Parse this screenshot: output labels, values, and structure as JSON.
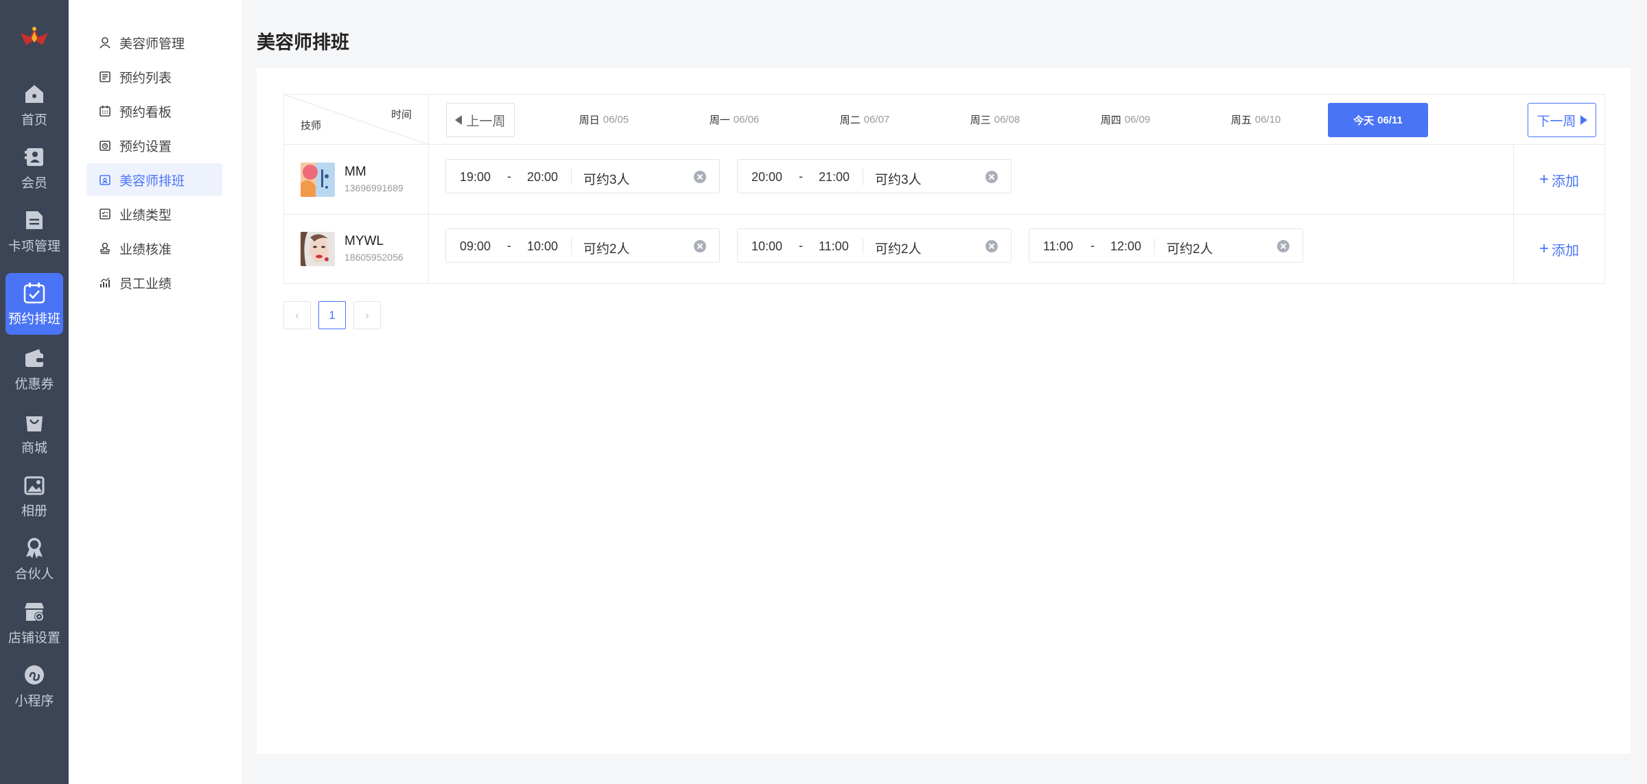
{
  "rail": {
    "items": [
      {
        "label": "首页",
        "icon": "home-icon"
      },
      {
        "label": "会员",
        "icon": "member-icon"
      },
      {
        "label": "卡项管理",
        "icon": "card-icon"
      },
      {
        "label": "预约排班",
        "icon": "calendar-icon"
      },
      {
        "label": "优惠券",
        "icon": "wallet-icon"
      },
      {
        "label": "商城",
        "icon": "bag-icon"
      },
      {
        "label": "相册",
        "icon": "album-icon"
      },
      {
        "label": "合伙人",
        "icon": "partner-icon"
      },
      {
        "label": "店铺设置",
        "icon": "store-settings-icon"
      },
      {
        "label": "小程序",
        "icon": "miniprogram-icon"
      }
    ],
    "active_index": 3,
    "accent": "#4a74f6",
    "bg": "#3c4556"
  },
  "submenu": {
    "items": [
      {
        "label": "美容师管理",
        "icon": "user-icon"
      },
      {
        "label": "预约列表",
        "icon": "list-icon"
      },
      {
        "label": "预约看板",
        "icon": "board-icon"
      },
      {
        "label": "预约设置",
        "icon": "clock-settings-icon"
      },
      {
        "label": "美容师排班",
        "icon": "schedule-icon"
      },
      {
        "label": "业绩类型",
        "icon": "checklist-icon"
      },
      {
        "label": "业绩核准",
        "icon": "stamp-icon"
      },
      {
        "label": "员工业绩",
        "icon": "bar-chart-icon"
      }
    ],
    "active_index": 4
  },
  "page": {
    "title": "美容师排班"
  },
  "schedule": {
    "corner": {
      "top": "时间",
      "bottom": "技师"
    },
    "prev_week": "上一周",
    "next_week": "下一周",
    "days": [
      {
        "name": "周日",
        "date": "06/05"
      },
      {
        "name": "周一",
        "date": "06/06"
      },
      {
        "name": "周二",
        "date": "06/07"
      },
      {
        "name": "周三",
        "date": "06/08"
      },
      {
        "name": "周四",
        "date": "06/09"
      },
      {
        "name": "周五",
        "date": "06/10"
      },
      {
        "name": "今天",
        "date": "06/11"
      }
    ],
    "add_label": "添加",
    "rows": [
      {
        "name": "MM",
        "phone": "13696991689",
        "slots": [
          {
            "start": "19:00",
            "end": "20:00",
            "capacity": "可约3人"
          },
          {
            "start": "20:00",
            "end": "21:00",
            "capacity": "可约3人"
          }
        ]
      },
      {
        "name": "MYWL",
        "phone": "18605952056",
        "slots": [
          {
            "start": "09:00",
            "end": "10:00",
            "capacity": "可约2人"
          },
          {
            "start": "10:00",
            "end": "11:00",
            "capacity": "可约2人"
          },
          {
            "start": "11:00",
            "end": "12:00",
            "capacity": "可约2人"
          }
        ]
      }
    ],
    "dash": "-"
  },
  "pager": {
    "prev": "‹",
    "current": "1",
    "next": "›"
  }
}
